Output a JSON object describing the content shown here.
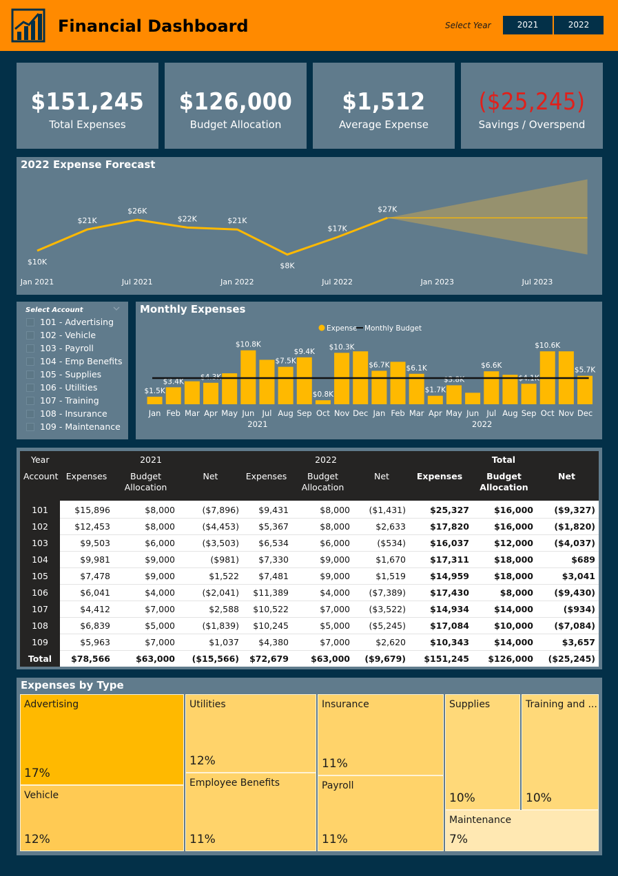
{
  "header": {
    "title": "Financial Dashboard",
    "select_year_label": "Select Year",
    "years": [
      "2021",
      "2022"
    ]
  },
  "kpis": [
    {
      "value": "$151,245",
      "label": "Total Expenses"
    },
    {
      "value": "$126,000",
      "label": "Budget Allocation"
    },
    {
      "value": "$1,512",
      "label": "Average Expense"
    },
    {
      "value": "($25,245)",
      "label": "Savings / Overspend"
    }
  ],
  "colors": {
    "background": "#033048",
    "header": "#FF8A00",
    "panel": "#607B8C",
    "bar": "#FFB900",
    "negative": "#E0201B",
    "forecast_band": "#9C946A"
  },
  "slicer": {
    "title": "Select Account",
    "items": [
      "101 - Advertising",
      "102 - Vehicle",
      "103 - Payroll",
      "104 - Emp Benefits",
      "105 - Supplies",
      "106 - Utilities",
      "107 - Training",
      "108 - Insurance",
      "109 - Maintenance"
    ]
  },
  "chart_data": [
    {
      "type": "line",
      "title": "2022 Expense Forecast",
      "x_ticks": [
        "Jan 2021",
        "Jul 2021",
        "Jan 2022",
        "Jul 2022",
        "Jan 2023",
        "Jul 2023"
      ],
      "points": [
        {
          "x": "Jan 2021",
          "y": 10,
          "label": "$10K"
        },
        {
          "x": "Apr 2021",
          "y": 21,
          "label": "$21K"
        },
        {
          "x": "Jul 2021",
          "y": 26,
          "label": "$26K"
        },
        {
          "x": "Oct 2021",
          "y": 22,
          "label": "$22K"
        },
        {
          "x": "Jan 2022",
          "y": 21,
          "label": "$21K"
        },
        {
          "x": "Apr 2022",
          "y": 8,
          "label": "$8K"
        },
        {
          "x": "Jul 2022",
          "y": 17,
          "label": "$17K"
        },
        {
          "x": "Oct 2022",
          "y": 27,
          "label": "$27K"
        }
      ],
      "forecast": {
        "x_start": "Oct 2022",
        "x_end": "Oct 2023",
        "y": 27,
        "band_low_end": 8,
        "band_high_end": 47
      }
    },
    {
      "type": "bar",
      "title": "Monthly Expenses",
      "legend": [
        "Expense",
        "Monthly Budget"
      ],
      "categories": [
        "Jan",
        "Feb",
        "Mar",
        "Apr",
        "May",
        "Jun",
        "Jul",
        "Aug",
        "Sep",
        "Oct",
        "Nov",
        "Dec",
        "Jan",
        "Feb",
        "Mar",
        "Apr",
        "May",
        "Jun",
        "Jul",
        "Aug",
        "Sep",
        "Oct",
        "Nov",
        "Dec"
      ],
      "year_labels": [
        "2021",
        "2022"
      ],
      "values": [
        1.5,
        3.4,
        4.6,
        4.3,
        6.2,
        10.8,
        8.9,
        7.5,
        9.4,
        0.8,
        10.3,
        10.6,
        6.7,
        8.5,
        6.1,
        1.7,
        3.8,
        2.3,
        6.6,
        5.9,
        4.1,
        10.6,
        10.6,
        5.7
      ],
      "data_labels": [
        "$1.5K",
        "$3.4K",
        "",
        "$4.3K",
        "",
        "$10.8K",
        "",
        "$7.5K",
        "$9.4K",
        "$0.8K",
        "$10.3K",
        "",
        "$6.7K",
        "",
        "$6.1K",
        "$1.7K",
        "$3.8K",
        "",
        "$6.6K",
        "",
        "$4.1K",
        "$10.6K",
        "",
        "$5.7K"
      ],
      "monthly_budget": 5.25
    }
  ],
  "matrix": {
    "year_header": "Year",
    "account_header": "Account",
    "groups": [
      "2021",
      "2022",
      "Total"
    ],
    "sub_headers": [
      "Expenses",
      "Budget Allocation",
      "Net",
      "Expenses",
      "Budget Allocation",
      "Net",
      "Expenses",
      "Budget Allocation",
      "Net"
    ],
    "rows": [
      {
        "account": "101",
        "cells": [
          "$15,896",
          "$8,000",
          "($7,896)",
          "$9,431",
          "$8,000",
          "($1,431)",
          "$25,327",
          "$16,000",
          "($9,327)"
        ]
      },
      {
        "account": "102",
        "cells": [
          "$12,453",
          "$8,000",
          "($4,453)",
          "$5,367",
          "$8,000",
          "$2,633",
          "$17,820",
          "$16,000",
          "($1,820)"
        ]
      },
      {
        "account": "103",
        "cells": [
          "$9,503",
          "$6,000",
          "($3,503)",
          "$6,534",
          "$6,000",
          "($534)",
          "$16,037",
          "$12,000",
          "($4,037)"
        ]
      },
      {
        "account": "104",
        "cells": [
          "$9,981",
          "$9,000",
          "($981)",
          "$7,330",
          "$9,000",
          "$1,670",
          "$17,311",
          "$18,000",
          "$689"
        ]
      },
      {
        "account": "105",
        "cells": [
          "$7,478",
          "$9,000",
          "$1,522",
          "$7,481",
          "$9,000",
          "$1,519",
          "$14,959",
          "$18,000",
          "$3,041"
        ]
      },
      {
        "account": "106",
        "cells": [
          "$6,041",
          "$4,000",
          "($2,041)",
          "$11,389",
          "$4,000",
          "($7,389)",
          "$17,430",
          "$8,000",
          "($9,430)"
        ]
      },
      {
        "account": "107",
        "cells": [
          "$4,412",
          "$7,000",
          "$2,588",
          "$10,522",
          "$7,000",
          "($3,522)",
          "$14,934",
          "$14,000",
          "($934)"
        ]
      },
      {
        "account": "108",
        "cells": [
          "$6,839",
          "$5,000",
          "($1,839)",
          "$10,245",
          "$5,000",
          "($5,245)",
          "$17,084",
          "$10,000",
          "($7,084)"
        ]
      },
      {
        "account": "109",
        "cells": [
          "$5,963",
          "$7,000",
          "$1,037",
          "$4,380",
          "$7,000",
          "$2,620",
          "$10,343",
          "$14,000",
          "$3,657"
        ]
      }
    ],
    "total_row": {
      "account": "Total",
      "cells": [
        "$78,566",
        "$63,000",
        "($15,566)",
        "$72,679",
        "$63,000",
        "($9,679)",
        "$151,245",
        "$126,000",
        "($25,245)"
      ]
    }
  },
  "treemap": {
    "title": "Expenses by Type",
    "blocks": [
      {
        "name": "Advertising",
        "pct": "17%",
        "color": "#FFB900"
      },
      {
        "name": "Vehicle",
        "pct": "12%",
        "color": "#FFCA53"
      },
      {
        "name": "Utilities",
        "pct": "12%",
        "color": "#FFD36A"
      },
      {
        "name": "Employee Benefits",
        "pct": "11%",
        "color": "#FFD36A"
      },
      {
        "name": "Insurance",
        "pct": "11%",
        "color": "#FFD36A"
      },
      {
        "name": "Payroll",
        "pct": "11%",
        "color": "#FFD36A"
      },
      {
        "name": "Supplies",
        "pct": "10%",
        "color": "#FFD979"
      },
      {
        "name": "Training and ...",
        "pct": "10%",
        "color": "#FFD979"
      },
      {
        "name": "Maintenance",
        "pct": "7%",
        "color": "#FFE8B2"
      }
    ]
  }
}
